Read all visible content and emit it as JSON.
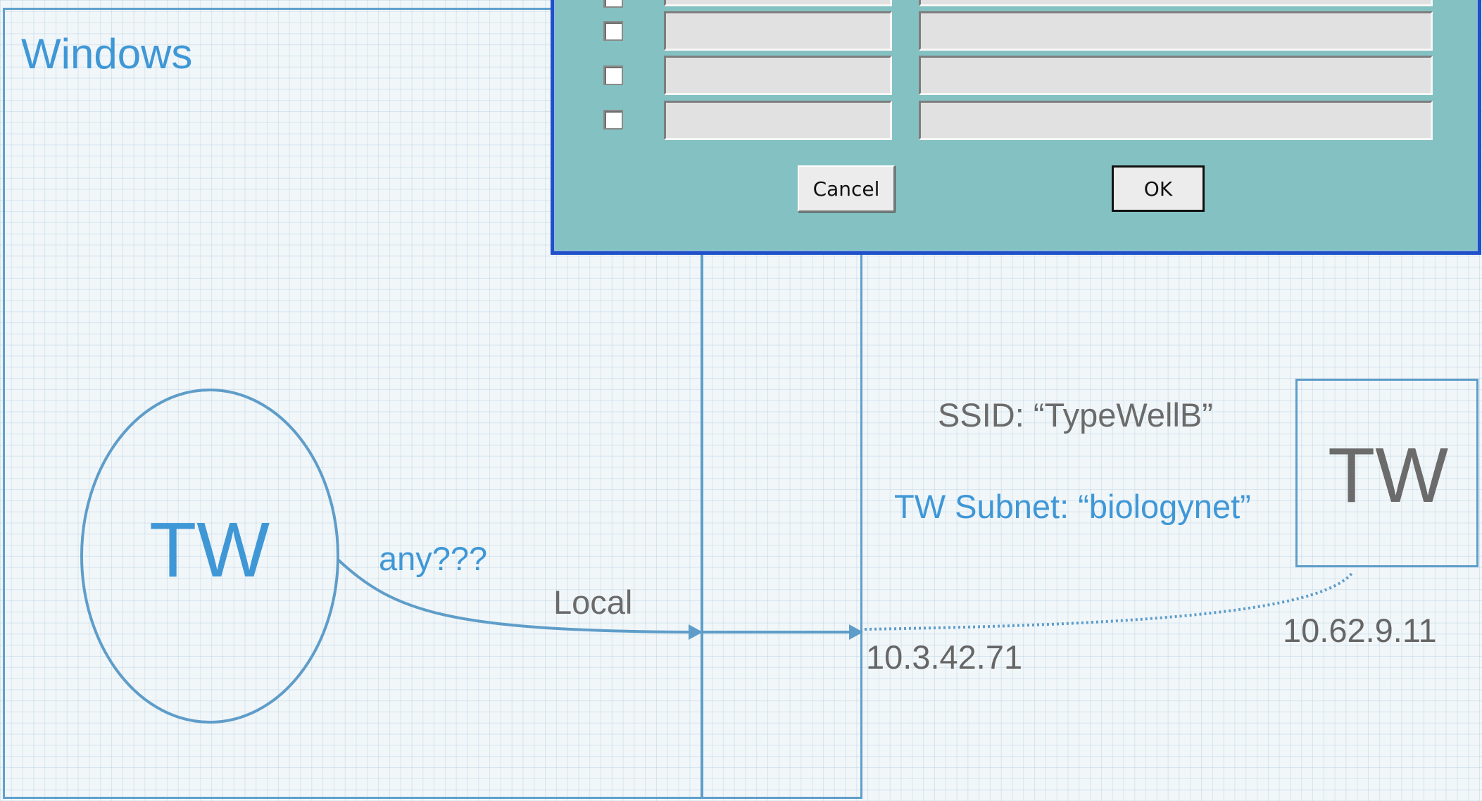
{
  "diagram": {
    "windows_label": "Windows",
    "local_node_label": "TW",
    "remote_node_label": "TW",
    "any_label": "any???",
    "local_label": "Local",
    "local_ip": "10.3.42.71",
    "remote_ip": "10.62.9.11",
    "ssid_text": "SSID: “TypeWellB”",
    "subnet_text": "TW Subnet: “biologynet”"
  },
  "dialog": {
    "rows": [
      {
        "checked": false,
        "name": "",
        "address": ""
      },
      {
        "checked": false,
        "name": "",
        "address": ""
      },
      {
        "checked": false,
        "name": "",
        "address": ""
      },
      {
        "checked": false,
        "name": "",
        "address": ""
      }
    ],
    "cancel_label": "Cancel",
    "ok_label": "OK"
  },
  "colors": {
    "accent_blue": "#3f97d6",
    "dialog_bg": "#84c1c2",
    "dialog_border": "#1f4fc9"
  }
}
